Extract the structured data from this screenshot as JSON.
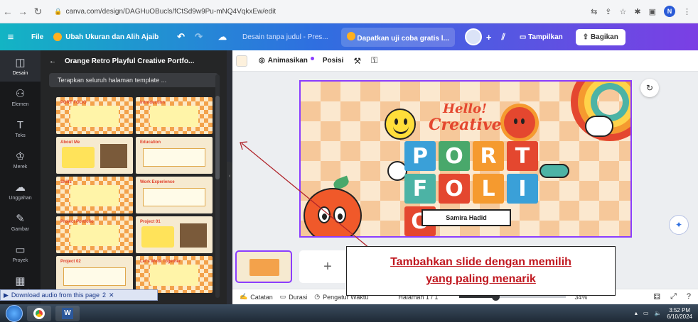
{
  "browser": {
    "url": "canva.com/design/DAGHuOBucls/fCtSd9w9Pu-mNQ4VqkxEw/edit"
  },
  "header": {
    "file": "File",
    "resize": "Ubah Ukuran dan Alih Ajaib",
    "doc_title": "Desain tanpa judul - Pres...",
    "trial": "Dapatkan uji coba gratis l...",
    "present": "Tampilkan",
    "share": "Bagikan"
  },
  "rail": [
    {
      "icon": "layout-icon",
      "glyph": "◫",
      "label": "Desain"
    },
    {
      "icon": "elements-icon",
      "glyph": "⚇",
      "label": "Elemen"
    },
    {
      "icon": "text-icon",
      "glyph": "T",
      "label": "Teks"
    },
    {
      "icon": "brand-icon",
      "glyph": "♔",
      "label": "Merek"
    },
    {
      "icon": "upload-icon",
      "glyph": "☁",
      "label": "Unggahan"
    },
    {
      "icon": "draw-icon",
      "glyph": "✎",
      "label": "Gambar"
    },
    {
      "icon": "projects-icon",
      "glyph": "▭",
      "label": "Proyek"
    },
    {
      "icon": "apps-icon",
      "glyph": "▦",
      "label": "Aplikasi"
    }
  ],
  "panel": {
    "title": "Orange Retro Playful Creative Portfo...",
    "apply_all": "Terapkan seluruh halaman template ...",
    "thumbs": [
      {
        "style": "t-check",
        "label": "PORT FOLIO"
      },
      {
        "style": "t-check",
        "label": "Introduction"
      },
      {
        "style": "t-yellow",
        "label": "About Me"
      },
      {
        "style": "t-cream",
        "label": "Education"
      },
      {
        "style": "t-check",
        "label": "Skills"
      },
      {
        "style": "t-cream",
        "label": "Work Experience"
      },
      {
        "style": "t-check",
        "label": "Project Portfolio"
      },
      {
        "style": "t-yellow",
        "label": "Project 01"
      },
      {
        "style": "t-cream",
        "label": "Project 02"
      },
      {
        "style": "t-check",
        "label": "Let's Work Together"
      }
    ]
  },
  "toolbar": {
    "animate": "Animasikan",
    "position": "Posisi"
  },
  "slide": {
    "hello": "Hello!",
    "creative": "Creative",
    "letters": [
      {
        "ch": "P",
        "color": "#3aa0d8"
      },
      {
        "ch": "O",
        "color": "#49a86b"
      },
      {
        "ch": "R",
        "color": "#f59a2f"
      },
      {
        "ch": "T",
        "color": "#e4472f"
      },
      {
        "ch": "F",
        "color": "#4cb3a5"
      },
      {
        "ch": "O",
        "color": "#e4472f"
      },
      {
        "ch": "L",
        "color": "#f59a2f"
      },
      {
        "ch": "I",
        "color": "#3aa0d8"
      },
      {
        "ch": "O",
        "color": "#e4472f"
      }
    ],
    "name": "Samira Hadid"
  },
  "footer": {
    "notes": "Catatan",
    "duration": "Durasi",
    "timer": "Pengatur Waktu",
    "page": "Halaman 1 / 1",
    "zoom_fraction": 0.34,
    "zoom": "34%"
  },
  "annotation": {
    "line1": "Tambahkan slide dengan memilih",
    "line2": "yang paling menarik"
  },
  "download": "Download audio from this page",
  "download_count": "2",
  "taskbar": {
    "time": "3:52 PM",
    "date": "6/10/2024"
  },
  "colors": {
    "accent": "#8b3dff",
    "annotation_text": "#c0171f"
  }
}
